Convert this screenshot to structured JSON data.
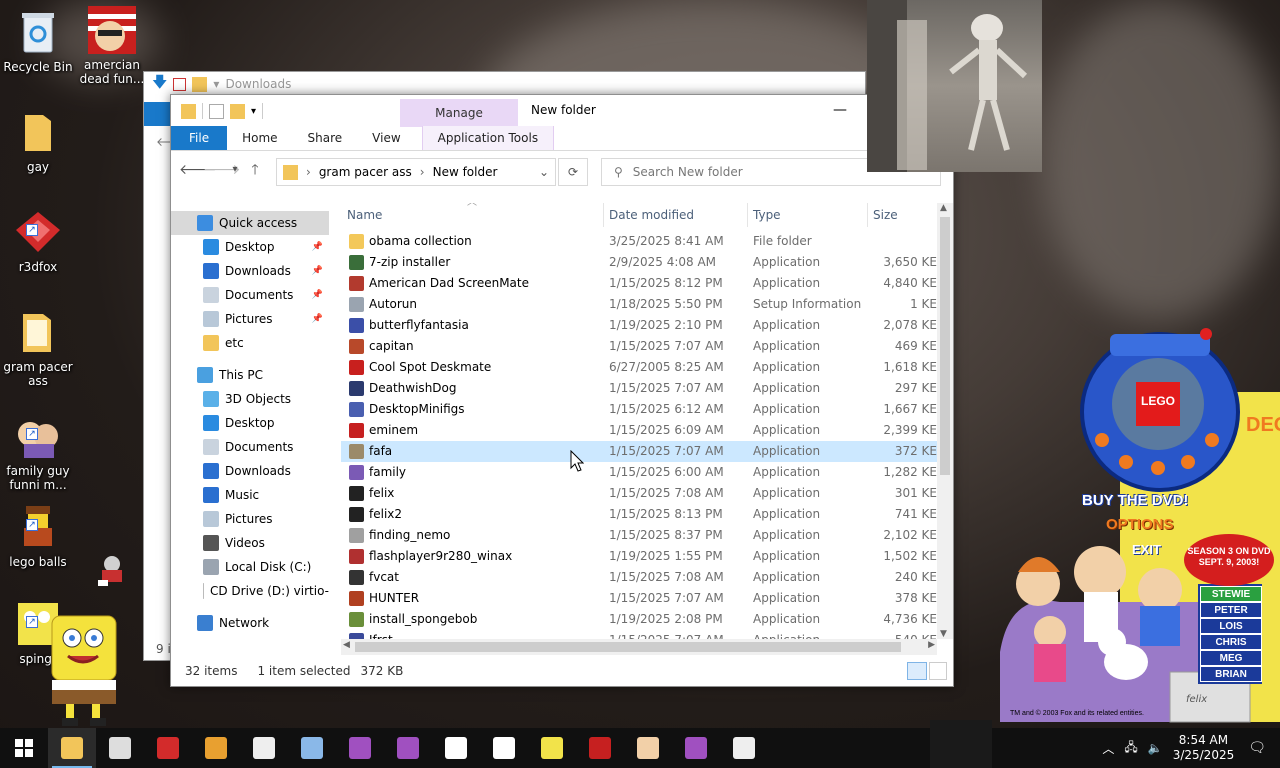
{
  "desktop": {
    "icons": [
      {
        "label": "Recycle Bin",
        "icon": "recycle-bin-icon"
      },
      {
        "label": "amercian dead fun...",
        "icon": "app-icon"
      },
      {
        "label": "gay",
        "icon": "folder-icon"
      },
      {
        "label": "r3dfox",
        "icon": "browser-icon"
      },
      {
        "label": "gram pacer ass",
        "icon": "folder-icon"
      },
      {
        "label": "family guy funni m...",
        "icon": "app-icon"
      },
      {
        "label": "lego balls",
        "icon": "app-icon"
      },
      {
        "label": "spingt",
        "icon": "app-icon"
      }
    ]
  },
  "back_window": {
    "title": "Downloads",
    "status": "9 i"
  },
  "explorer": {
    "title": "New folder",
    "manage_label": "Manage",
    "tabs": {
      "file": "File",
      "home": "Home",
      "share": "Share",
      "view": "View",
      "app_tools": "Application Tools"
    },
    "address": {
      "segment1": "gram pacer ass",
      "segment2": "New folder"
    },
    "search_placeholder": "Search New folder",
    "nav": {
      "quick_access": "Quick access",
      "qa_items": [
        "Desktop",
        "Downloads",
        "Documents",
        "Pictures",
        "etc"
      ],
      "this_pc": "This PC",
      "pc_items": [
        "3D Objects",
        "Desktop",
        "Documents",
        "Downloads",
        "Music",
        "Pictures",
        "Videos",
        "Local Disk (C:)",
        "CD Drive (D:) virtio-"
      ],
      "network": "Network"
    },
    "columns": {
      "name": "Name",
      "date": "Date modified",
      "type": "Type",
      "size": "Size"
    },
    "files": [
      {
        "name": "obama collection",
        "date": "3/25/2025 8:41 AM",
        "type": "File folder",
        "size": "",
        "color": "#f3c85a"
      },
      {
        "name": "7-zip installer",
        "date": "2/9/2025 4:08 AM",
        "type": "Application",
        "size": "3,650 KE",
        "color": "#3a6e3a"
      },
      {
        "name": "American Dad ScreenMate",
        "date": "1/15/2025 8:12 PM",
        "type": "Application",
        "size": "4,840 KE",
        "color": "#b23a2e"
      },
      {
        "name": "Autorun",
        "date": "1/18/2025 5:50 PM",
        "type": "Setup Information",
        "size": "1 KE",
        "color": "#9aa4b0"
      },
      {
        "name": "butterflyfantasia",
        "date": "1/19/2025 2:10 PM",
        "type": "Application",
        "size": "2,078 KE",
        "color": "#3b4fa8"
      },
      {
        "name": "capitan",
        "date": "1/15/2025 7:07 AM",
        "type": "Application",
        "size": "469 KE",
        "color": "#b8492a"
      },
      {
        "name": "Cool Spot Deskmate",
        "date": "6/27/2005 8:25 AM",
        "type": "Application",
        "size": "1,618 KE",
        "color": "#c8201e"
      },
      {
        "name": "DeathwishDog",
        "date": "1/15/2025 7:07 AM",
        "type": "Application",
        "size": "297 KE",
        "color": "#2b3a6e"
      },
      {
        "name": "DesktopMinifigs",
        "date": "1/15/2025 6:12 AM",
        "type": "Application",
        "size": "1,667 KE",
        "color": "#4a5fb0"
      },
      {
        "name": "eminem",
        "date": "1/15/2025 6:09 AM",
        "type": "Application",
        "size": "2,399 KE",
        "color": "#c62020"
      },
      {
        "name": "fafa",
        "date": "1/15/2025 7:07 AM",
        "type": "Application",
        "size": "372 KE",
        "color": "#9b8a6a"
      },
      {
        "name": "family",
        "date": "1/15/2025 6:00 AM",
        "type": "Application",
        "size": "1,282 KE",
        "color": "#7b5ab5"
      },
      {
        "name": "felix",
        "date": "1/15/2025 7:08 AM",
        "type": "Application",
        "size": "301 KE",
        "color": "#222222"
      },
      {
        "name": "felix2",
        "date": "1/15/2025 8:13 PM",
        "type": "Application",
        "size": "741 KE",
        "color": "#222222"
      },
      {
        "name": "finding_nemo",
        "date": "1/15/2025 8:37 PM",
        "type": "Application",
        "size": "2,102 KE",
        "color": "#a0a0a0"
      },
      {
        "name": "flashplayer9r280_winax",
        "date": "1/19/2025 1:55 PM",
        "type": "Application",
        "size": "1,502 KE",
        "color": "#b03030"
      },
      {
        "name": "fvcat",
        "date": "1/15/2025 7:08 AM",
        "type": "Application",
        "size": "240 KE",
        "color": "#333333"
      },
      {
        "name": "HUNTER",
        "date": "1/15/2025 7:07 AM",
        "type": "Application",
        "size": "378 KE",
        "color": "#b04020"
      },
      {
        "name": "install_spongebob",
        "date": "1/19/2025 2:08 PM",
        "type": "Application",
        "size": "4,736 KE",
        "color": "#6a8f3a"
      },
      {
        "name": "Jfrst",
        "date": "1/15/2025 7:07 AM",
        "type": "Application",
        "size": "540 KE",
        "color": "#3a4a9a"
      }
    ],
    "status": {
      "count": "32 items",
      "selected": "1 item selected",
      "size": "372 KB"
    }
  },
  "taskbar": {
    "apps": [
      "start-icon",
      "file-explorer-icon",
      "settings-icon",
      "r3dfox-icon",
      "media-player-icon",
      "7zip-icon",
      "notepad-icon",
      "app-icon",
      "app-icon",
      "felix-icon",
      "hello-kitty-icon",
      "spongebob-icon",
      "eminem-icon",
      "american-dad-icon",
      "app-icon",
      "list-icon"
    ],
    "time": "8:54 AM",
    "date": "3/25/2025"
  },
  "ad": {
    "logo": "LEGO",
    "buy": "BUY THE DVD!",
    "options": "OPTIONS",
    "exit": "EXIT",
    "season": "SEASON 3 ON DVD SEPT. 9, 2003!",
    "characters": [
      "STEWIE",
      "PETER",
      "LOIS",
      "CHRIS",
      "MEG",
      "BRIAN"
    ],
    "copyright": "TM and © 2003 Fox and its related entities.",
    "edge": "DEON",
    "felix": "felix"
  }
}
